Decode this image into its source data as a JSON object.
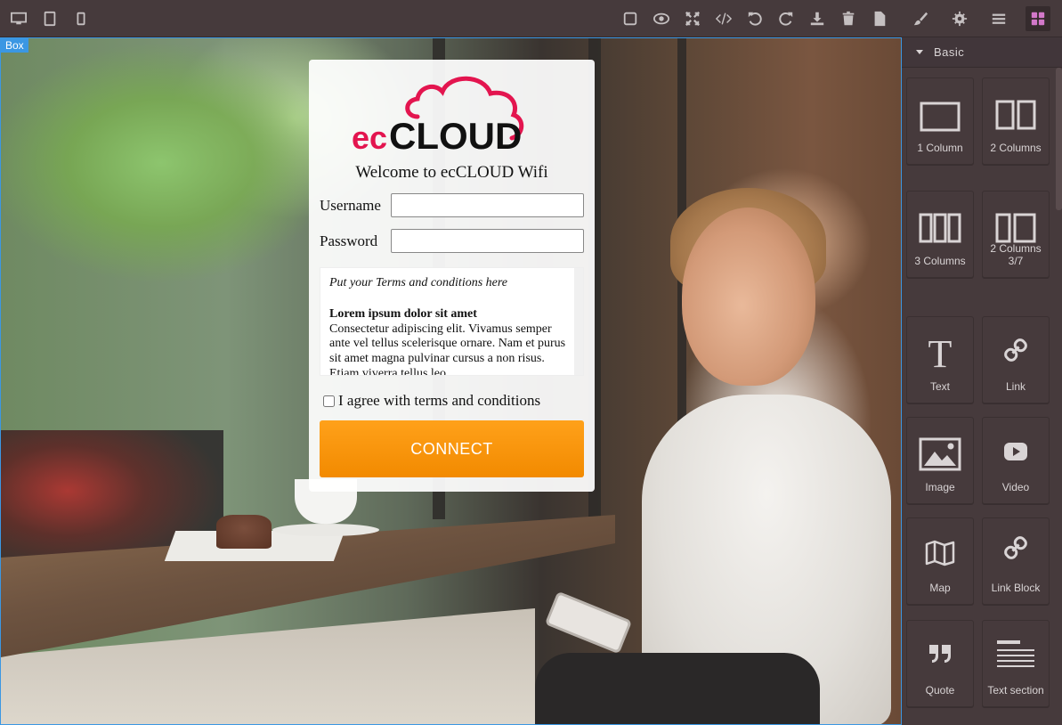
{
  "toolbar": {
    "left_icons": [
      "desktop-icon",
      "tablet-icon",
      "mobile-icon"
    ],
    "right_icons": [
      "square-icon",
      "eye-icon",
      "fullscreen-icon",
      "code-icon",
      "undo-icon",
      "redo-icon",
      "download-icon",
      "trash-icon",
      "file-icon"
    ],
    "panel_icons": [
      "paint-brush-icon",
      "gear-icon",
      "menu-icon",
      "blocks-icon"
    ],
    "active_color": "#d278c9"
  },
  "canvas": {
    "selected_label": "Box",
    "selection_color": "#3b97e3"
  },
  "login": {
    "logo_text_ec": "ec",
    "logo_text_cloud": "CLOUD",
    "logo_color": "#e3154f",
    "welcome": "Welcome to ecCLOUD Wifi",
    "username_label": "Username",
    "username_value": "",
    "password_label": "Password",
    "password_value": "",
    "terms_intro": "Put your Terms and conditions here",
    "terms_title": "Lorem ipsum dolor sit amet",
    "terms_body": "Consectetur adipiscing elit. Vivamus semper ante vel tellus scelerisque ornare. Nam et purus sit amet magna pulvinar cursus a non risus. Etiam viverra tellus leo.",
    "agree_label": "I agree with terms and conditions",
    "agree_checked": false,
    "connect_label": "CONNECT",
    "connect_color": "#f7920c"
  },
  "panel": {
    "category": "Basic",
    "blocks": [
      {
        "label": "1 Column",
        "icon": "one-column-icon"
      },
      {
        "label": "2 Columns",
        "icon": "two-columns-icon"
      },
      {
        "label": "3 Columns",
        "icon": "three-columns-icon"
      },
      {
        "label": "2 Columns 3/7",
        "icon": "two-columns-37-icon"
      },
      {
        "label": "Text",
        "icon": "text-icon"
      },
      {
        "label": "Link",
        "icon": "link-icon"
      },
      {
        "label": "Image",
        "icon": "image-icon"
      },
      {
        "label": "Video",
        "icon": "video-icon"
      },
      {
        "label": "Map",
        "icon": "map-icon"
      },
      {
        "label": "Link Block",
        "icon": "link-block-icon"
      },
      {
        "label": "Quote",
        "icon": "quote-icon"
      },
      {
        "label": "Text section",
        "icon": "text-section-icon"
      }
    ]
  }
}
